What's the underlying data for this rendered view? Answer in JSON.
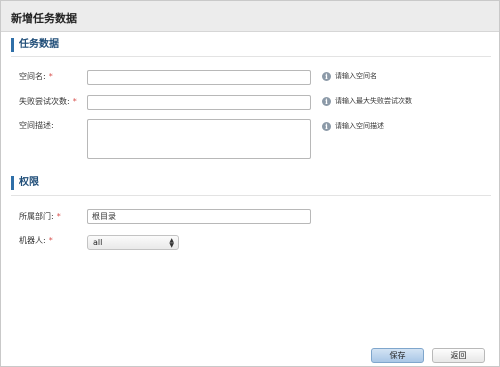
{
  "header": {
    "title": "新增任务数据"
  },
  "sections": {
    "task": {
      "title": "任务数据"
    },
    "permission": {
      "title": "权限"
    }
  },
  "fields": {
    "space_name": {
      "label": "空间名:",
      "required": "*",
      "value": "",
      "hint": "请输入空间名"
    },
    "max_failures": {
      "label": "失败尝试次数:",
      "required": "*",
      "value": "",
      "hint": "请输入最大失败尝试次数"
    },
    "space_desc": {
      "label": "空间描述:",
      "value": "",
      "hint": "请输入空间描述"
    },
    "department": {
      "label": "所属部门:",
      "required": "*",
      "value": "根目录"
    },
    "robot": {
      "label": "机器人:",
      "required": "*",
      "selected": "all"
    }
  },
  "hint_icon": "info-icon",
  "buttons": {
    "save": "保存",
    "back": "返回"
  },
  "colors": {
    "accent": "#2f6fa8",
    "required": "#d9534f"
  }
}
